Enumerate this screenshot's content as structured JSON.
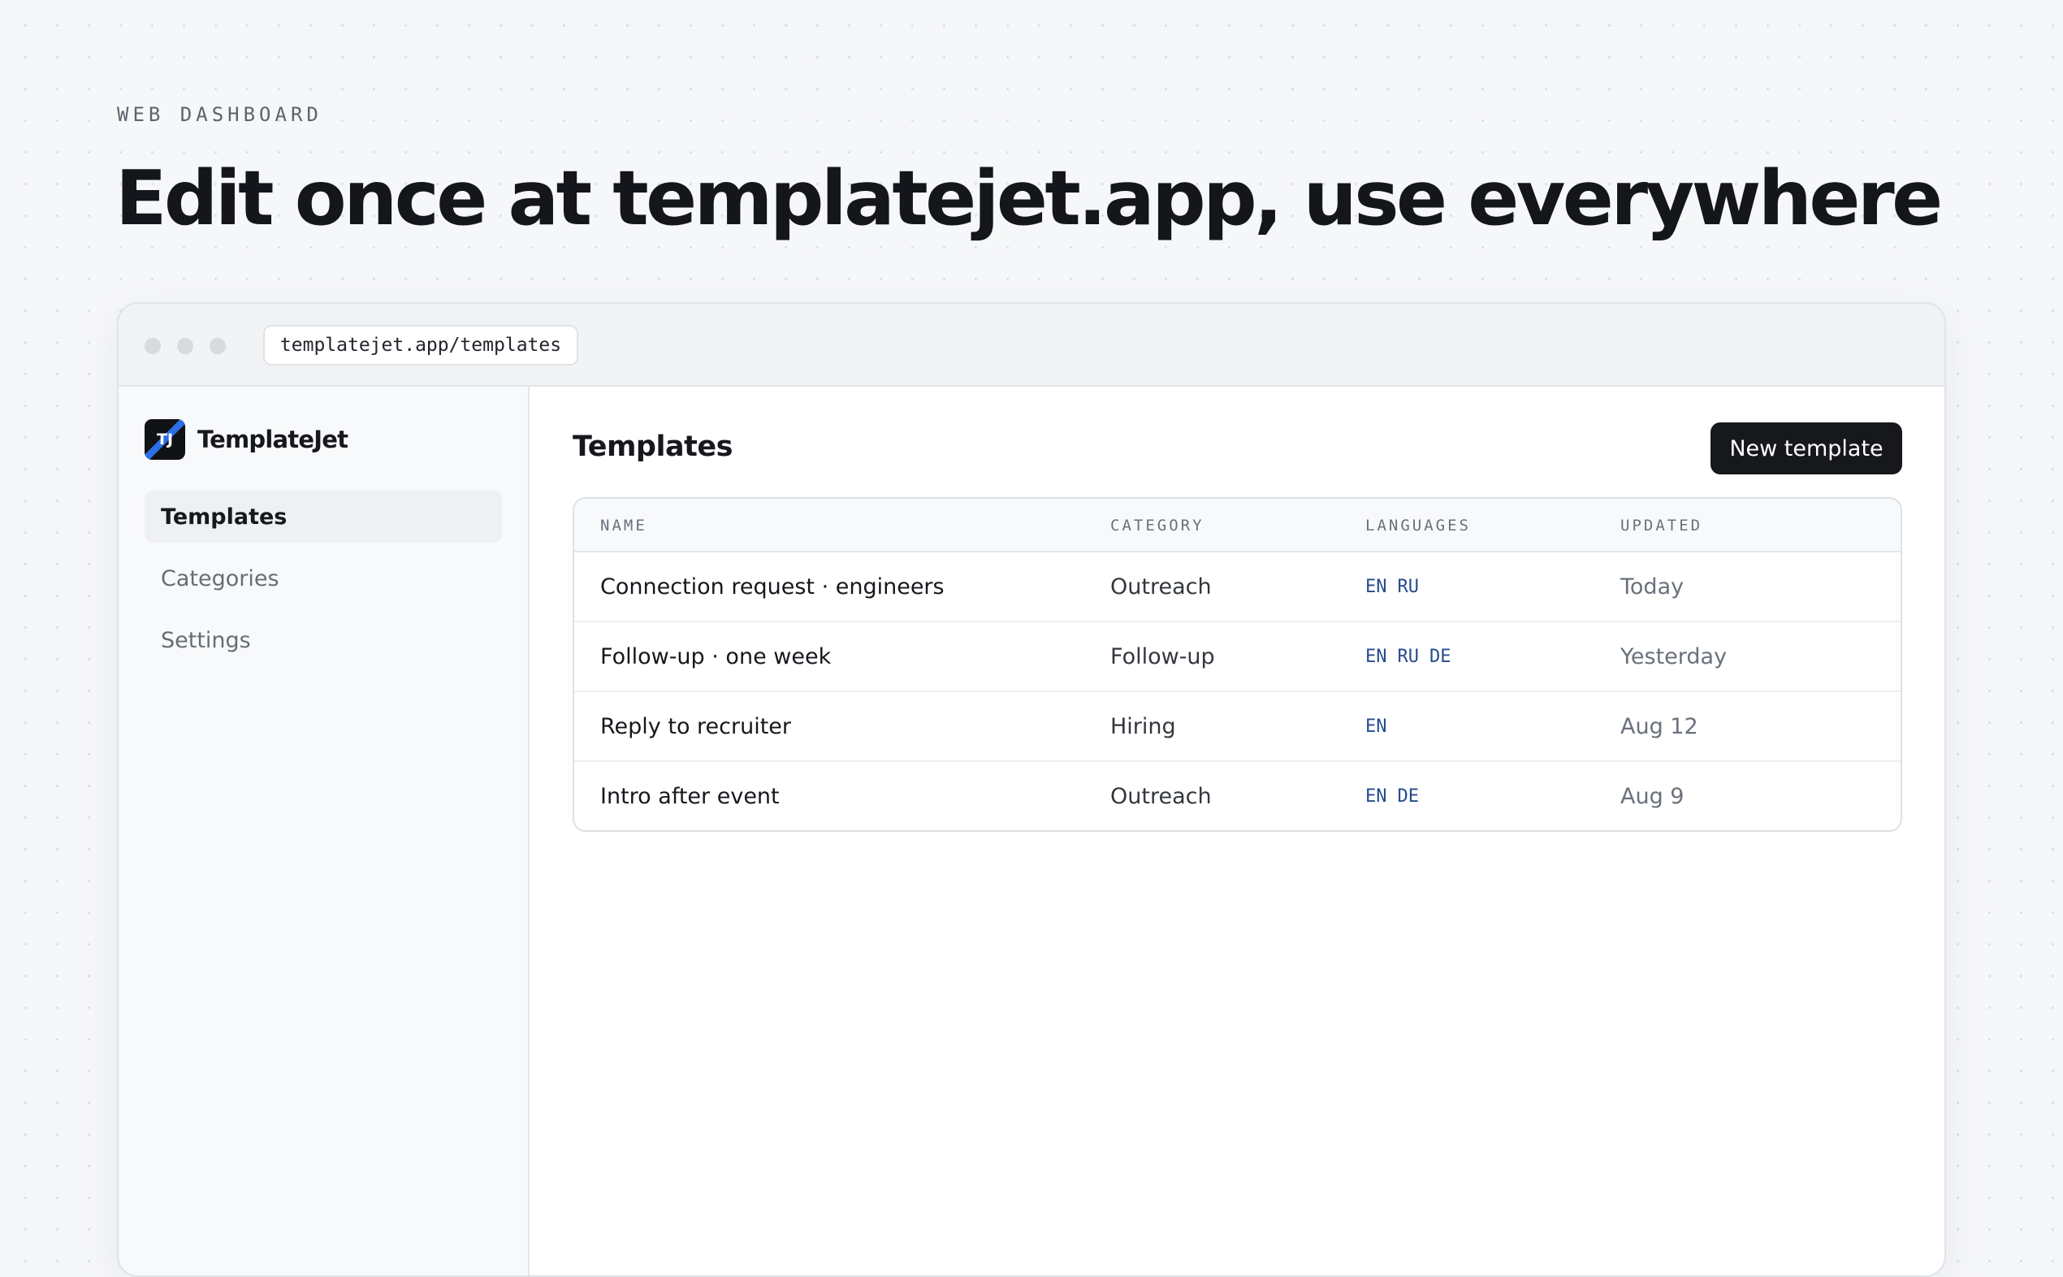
{
  "eyebrow": "WEB DASHBOARD",
  "headline": "Edit once at templatejet.app, use everywhere",
  "browser": {
    "url": "templatejet.app/templates"
  },
  "app": {
    "logo_text": "TJ",
    "name": "TemplateJet",
    "accent_color": "#2e6ee6"
  },
  "sidebar": {
    "items": [
      {
        "label": "Templates",
        "active": true
      },
      {
        "label": "Categories",
        "active": false
      },
      {
        "label": "Settings",
        "active": false
      }
    ]
  },
  "main": {
    "title": "Templates",
    "new_button": "New template",
    "table": {
      "columns": [
        "NAME",
        "CATEGORY",
        "LANGUAGES",
        "UPDATED"
      ],
      "rows": [
        {
          "name": "Connection request · engineers",
          "category": "Outreach",
          "languages": [
            "EN",
            "RU"
          ],
          "updated": "Today"
        },
        {
          "name": "Follow-up · one week",
          "category": "Follow-up",
          "languages": [
            "EN",
            "RU",
            "DE"
          ],
          "updated": "Yesterday"
        },
        {
          "name": "Reply to recruiter",
          "category": "Hiring",
          "languages": [
            "EN"
          ],
          "updated": "Aug 12"
        },
        {
          "name": "Intro after event",
          "category": "Outreach",
          "languages": [
            "EN",
            "DE"
          ],
          "updated": "Aug 9"
        }
      ]
    }
  }
}
